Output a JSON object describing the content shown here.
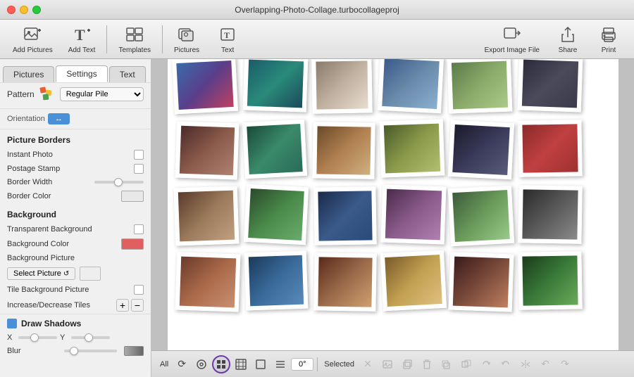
{
  "window": {
    "title": "Overlapping-Photo-Collage.turbocollageproj"
  },
  "tabs": {
    "pictures": "Pictures",
    "settings": "Settings",
    "text": "Text",
    "active": "Settings"
  },
  "toolbar": {
    "add_pictures": "Add Pictures",
    "add_text": "Add Text",
    "templates": "Templates",
    "pictures": "Pictures",
    "text": "Text",
    "export_image_file": "Export Image File",
    "share": "Share",
    "print": "Print"
  },
  "sidebar": {
    "pattern_label": "Pattern",
    "pattern_value": "Regular Pile",
    "orientation_label": "Orientation",
    "picture_borders_title": "Picture Borders",
    "instant_photo": "Instant Photo",
    "postage_stamp": "Postage Stamp",
    "border_width": "Border Width",
    "border_color": "Border Color",
    "border_color_value": "#e8e8e8",
    "background_title": "Background",
    "transparent_background": "Transparent Background",
    "background_color": "Background Color",
    "background_color_value": "#e06060",
    "background_picture": "Background Picture",
    "select_picture": "Select Picture",
    "tile_background": "Tile Background Picture",
    "increase_decrease": "Increase/Decrease Tiles",
    "draw_shadows": "Draw Shadows",
    "x_label": "X",
    "y_label": "Y",
    "blur_label": "Blur"
  },
  "bottom_toolbar": {
    "all_label": "All",
    "selected_label": "Selected",
    "degrees": "0°"
  }
}
